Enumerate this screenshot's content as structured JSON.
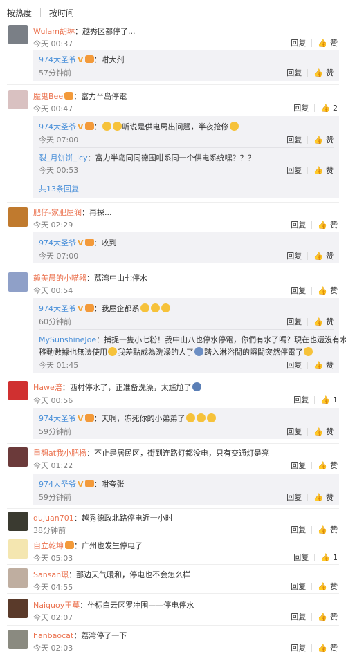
{
  "tabs": [
    "按热度",
    "按时间"
  ],
  "actions": {
    "reply": "回复",
    "like": "赞"
  },
  "colors": {
    "username": "#eb7350",
    "reply_username": "#4a90d9",
    "time": "#808080"
  },
  "comments": [
    {
      "user": "Wulam胡琳",
      "text": "：越秀区都停了...",
      "time": "今天 00:37",
      "likes": "赞",
      "replies": [
        {
          "user": "974大圣爷",
          "text": "：咁大剂",
          "time": "57分钟前",
          "likes": "赞"
        }
      ]
    },
    {
      "user": "魔鬼Bee",
      "text": "：富力半岛停電",
      "time": "今天 00:47",
      "likes": "2",
      "replies": [
        {
          "user": "974大圣爷",
          "text": "听说是供电局出问题，半夜抢修",
          "time": "今天 07:00",
          "likes": "赞"
        },
        {
          "user": "裂_月饼饼_icy",
          "text": "：富力半岛同同德围咁系同一个供电系统嘿？？？",
          "time": "今天 00:53",
          "likes": "赞"
        }
      ],
      "more": "共13条回复"
    },
    {
      "user": "肥仔-家肥屋润",
      "text": "：再探...",
      "time": "今天 02:29",
      "likes": "赞",
      "replies": [
        {
          "user": "974大圣爷",
          "text": "：收到",
          "time": "今天 07:00",
          "likes": "赞"
        }
      ]
    },
    {
      "user": "赖美晨的小喵器",
      "text": "：荔湾中山七停水",
      "time": "今天 00:54",
      "likes": "赞",
      "replies": [
        {
          "user": "974大圣爷",
          "text": "：我屋企都系",
          "time": "60分钟前",
          "likes": "赞"
        },
        {
          "user": "MySunshineJoe",
          "text": "：捕捉一隻小七粉！我中山八也停水停電，你們有水了嗎？現在也還沒有水，",
          "text2": "移動數據也無法使用",
          "text3": "我差點成為洗澡的人了",
          "text4": "踏入淋浴間的瞬間突然停電了",
          "time": "今天 01:45",
          "likes": "赞"
        }
      ]
    },
    {
      "user": "Hawe涪",
      "text": "：西村停水了，正准备洗澡，太尴尬了",
      "time": "今天 00:56",
      "likes": "1",
      "replies": [
        {
          "user": "974大圣爷",
          "text": "：天啊，冻死你的小弟弟了",
          "time": "59分钟前",
          "likes": "赞"
        }
      ]
    },
    {
      "user": "重想at我小肥杨",
      "text": "：不止是居民区，街到连路灯都没电，只有交通灯是亮",
      "time": "今天 01:22",
      "likes": "赞",
      "replies": [
        {
          "user": "974大圣爷",
          "text": "：咁夸张",
          "time": "59分钟前",
          "likes": "赞"
        }
      ]
    },
    {
      "user": "dujuan701",
      "text": "：越秀德政北路停电近一小时",
      "time": "38分钟前",
      "likes": "赞",
      "replies": []
    },
    {
      "user": "自立乾坤",
      "text": "：广州也发生停电了",
      "time": "今天 05:03",
      "likes": "1",
      "replies": []
    },
    {
      "user": "Sansan璟",
      "text": "：那边天气暖和，停电也不会怎么样",
      "time": "今天 04:55",
      "likes": "赞",
      "replies": []
    },
    {
      "user": "Naiquoy王莫",
      "text": "：坐标白云区罗冲围——停电停水",
      "time": "今天 02:07",
      "likes": "赞",
      "replies": []
    },
    {
      "user": "hanbaocat",
      "text": "：荔湾停了一下",
      "time": "今天 02:03",
      "likes": "赞",
      "replies": []
    }
  ]
}
